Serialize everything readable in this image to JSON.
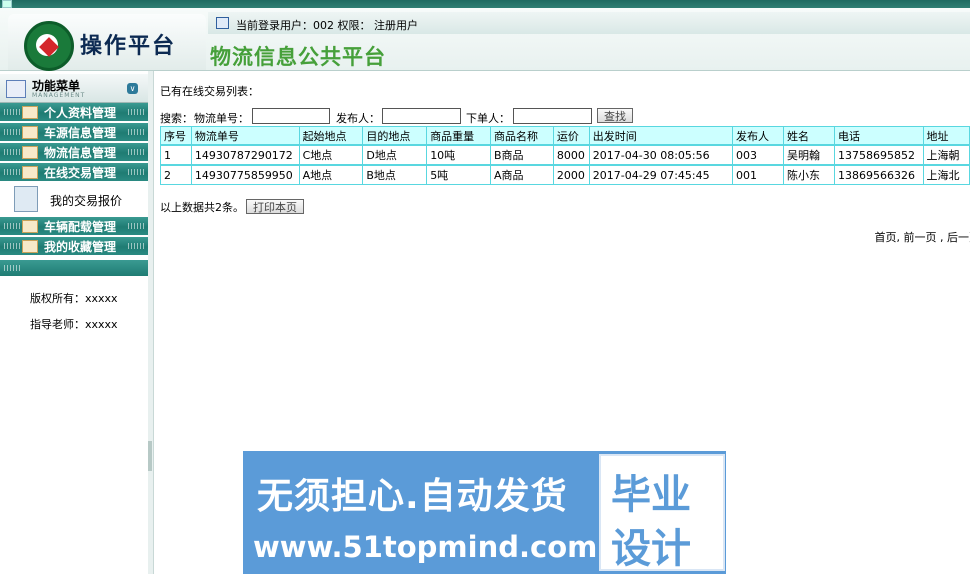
{
  "header": {
    "logo_text": "操作平台",
    "user_info": "当前登录用户：002  权限：  注册用户",
    "site_title": "物流信息公共平台"
  },
  "sidebar": {
    "title": "功能菜单",
    "subtitle": "MANAGEMENT",
    "menu_items": [
      {
        "label": "个人资料管理"
      },
      {
        "label": "车源信息管理"
      },
      {
        "label": "物流信息管理"
      },
      {
        "label": "在线交易管理"
      }
    ],
    "active_sub_item": "我的交易报价",
    "menu_items_after": [
      {
        "label": "车辆配载管理"
      },
      {
        "label": "我的收藏管理"
      }
    ],
    "copyright": "版权所有：xxxxx",
    "advisor": "指导老师：xxxxx"
  },
  "main": {
    "caption": "已有在线交易列表：",
    "search": {
      "label": "搜索：",
      "field1_label": "物流单号：",
      "field2_label": "发布人：",
      "field3_label": "下单人：",
      "field1_value": "",
      "field2_value": "",
      "field3_value": "",
      "button": "查找"
    },
    "table": {
      "headers": [
        "序号",
        "物流单号",
        "起始地点",
        "目的地点",
        "商品重量",
        "商品名称",
        "运价",
        "出发时间",
        "发布人",
        "姓名",
        "电话",
        "地址"
      ],
      "rows": [
        [
          "1",
          "14930787290172",
          "C地点",
          "D地点",
          "10吨",
          "B商品",
          "8000",
          "2017-04-30 08:05:56",
          "003",
          "吴明翰",
          "13758695852",
          "上海朝"
        ],
        [
          "2",
          "14930775859950",
          "A地点",
          "B地点",
          "5吨",
          "A商品",
          "2000",
          "2017-04-29 07:45:45",
          "001",
          "陈小东",
          "13869566326",
          "上海北"
        ]
      ]
    },
    "summary": "以上数据共2条。",
    "print_button": "打印本页",
    "pager": "首页, 前一页 , 后一页"
  },
  "watermark": {
    "line1": "无须担心.自动发货",
    "line2": "www.51topmind.com",
    "box_line1": "毕业",
    "box_line2": "设计"
  },
  "colors": {
    "menu_teal": "#1f7c73",
    "table_border": "#59d7e0",
    "table_header_bg": "#ccffff",
    "site_title_green": "#46a03a",
    "watermark_blue": "#5b9bd8"
  }
}
